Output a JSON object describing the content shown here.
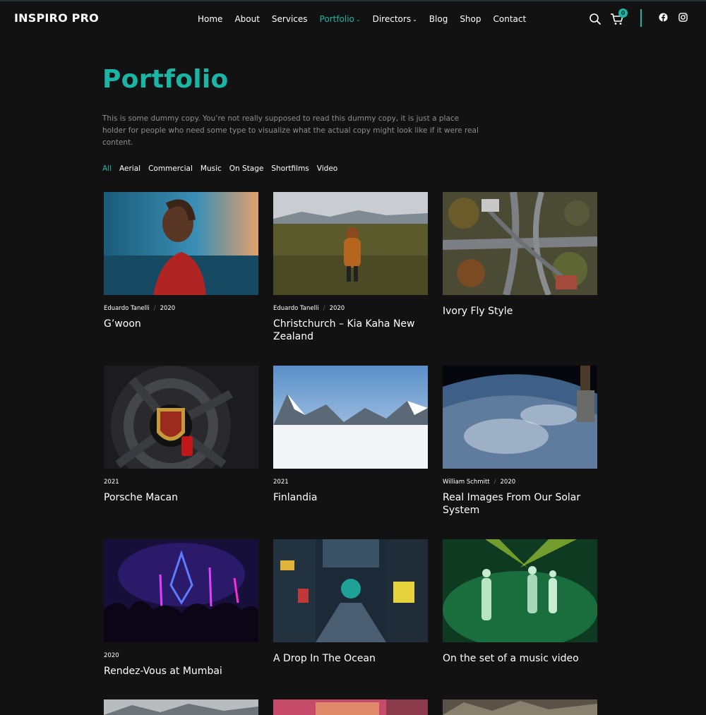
{
  "site": {
    "logo": "INSPIRO PRO"
  },
  "nav": {
    "items": [
      {
        "label": "Home",
        "active": false,
        "dropdown": false
      },
      {
        "label": "About",
        "active": false,
        "dropdown": false
      },
      {
        "label": "Services",
        "active": false,
        "dropdown": false
      },
      {
        "label": "Portfolio",
        "active": true,
        "dropdown": true
      },
      {
        "label": "Directors",
        "active": false,
        "dropdown": true
      },
      {
        "label": "Blog",
        "active": false,
        "dropdown": false
      },
      {
        "label": "Shop",
        "active": false,
        "dropdown": false
      },
      {
        "label": "Contact",
        "active": false,
        "dropdown": false
      }
    ],
    "cart_count": "0",
    "icons": [
      "search-icon",
      "cart-icon",
      "facebook-icon",
      "instagram-icon"
    ]
  },
  "colors": {
    "accent": "#1bb5a6",
    "background": "#121212",
    "muted_text": "#8e8e8e"
  },
  "page": {
    "title": "Portfolio",
    "intro": "This is some dummy copy. You’re not really supposed to read this dummy copy, it is just a place holder for people who need some type to visualize what the actual copy might look like if it were real content."
  },
  "filters": [
    "All",
    "Aerial",
    "Commercial",
    "Music",
    "On Stage",
    "Shortfilms",
    "Video"
  ],
  "active_filter": "All",
  "portfolio": [
    {
      "author": "Eduardo Tanelli",
      "year": "2020",
      "title": "G’woon"
    },
    {
      "author": "Eduardo Tanelli",
      "year": "2020",
      "title": "Christchurch – Kia Kaha New Zealand"
    },
    {
      "author": "",
      "year": "",
      "title": "Ivory Fly Style"
    },
    {
      "author": "",
      "year": "2021",
      "title": "Porsche Macan"
    },
    {
      "author": "",
      "year": "2021",
      "title": "Finlandia"
    },
    {
      "author": "William Schmitt",
      "year": "2020",
      "title": "Real Images From Our Solar System"
    },
    {
      "author": "",
      "year": "2020",
      "title": "Rendez-Vous at Mumbai"
    },
    {
      "author": "",
      "year": "",
      "title": "A Drop In The Ocean"
    },
    {
      "author": "",
      "year": "",
      "title": "On the set of a music video"
    }
  ]
}
